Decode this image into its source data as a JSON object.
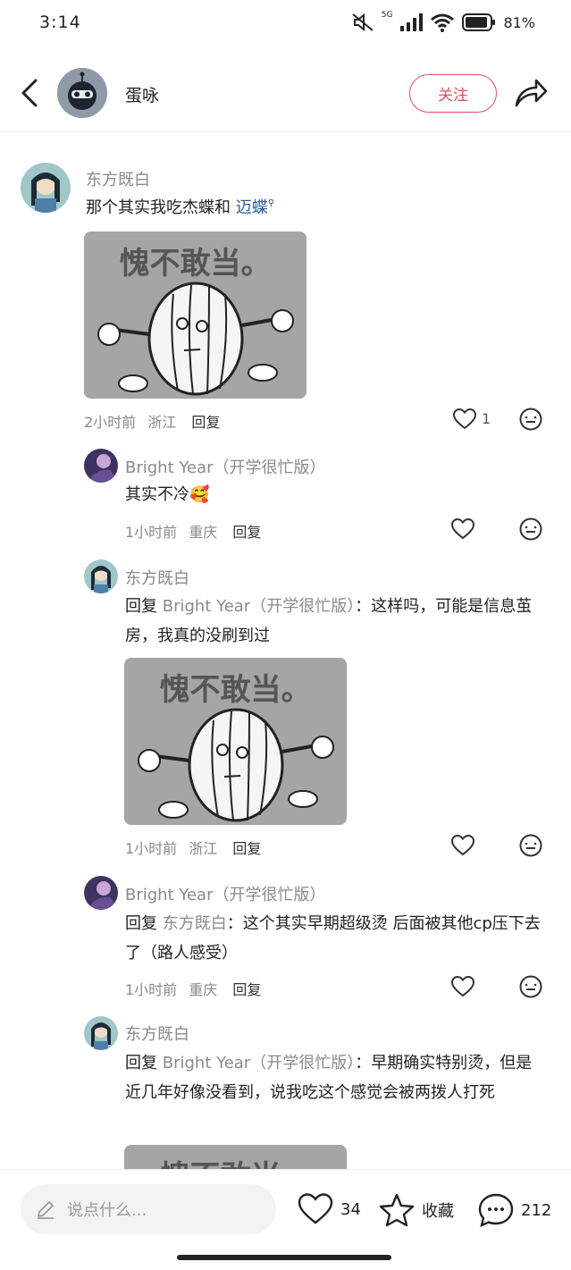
{
  "status_bar": {
    "time": "3:14",
    "network": "5G",
    "battery": "81%"
  },
  "header": {
    "title": "蛋咏",
    "follow_label": "关注"
  },
  "comments": [
    {
      "name": "东方既白",
      "text_prefix": "那个其实我吃杰蝶和 ",
      "link_text": "迈蝶",
      "meme_caption": "愧不敢当。",
      "time": "2小时前",
      "location": "浙江",
      "reply_label": "回复",
      "likes": "1"
    },
    {
      "name": "Bright Year（开学很忙版）",
      "text": "其实不冷",
      "emoji": "🥰",
      "time": "1小时前",
      "location": "重庆",
      "reply_label": "回复"
    },
    {
      "name": "东方既白",
      "reply_word": "回复 ",
      "reply_target": "Bright Year（开学很忙版）",
      "text": "：这样吗，可能是信息茧房，我真的没刷到过",
      "meme_caption": "愧不敢当。",
      "time": "1小时前",
      "location": "浙江",
      "reply_label": "回复"
    },
    {
      "name": "Bright Year（开学很忙版）",
      "reply_word": "回复 ",
      "reply_target": "东方既白",
      "text": "：这个其实早期超级烫 后面被其他cp压下去了（路人感受）",
      "time": "1小时前",
      "location": "重庆",
      "reply_label": "回复"
    },
    {
      "name": "东方既白",
      "reply_word": "回复 ",
      "reply_target": "Bright Year（开学很忙版）",
      "text": "：早期确实特别烫，但是近几年好像没看到，说我吃这个感觉会被两拨人打死",
      "meme_caption": "愧不敢当。"
    }
  ],
  "bottom_bar": {
    "input_placeholder": "说点什么...",
    "likes": "34",
    "favorite_label": "收藏",
    "comments": "212"
  },
  "colors": {
    "accent": "#e0505a",
    "link": "#2f5b9a",
    "muted": "#8a8a8a"
  },
  "icons": [
    "back-icon",
    "share-icon",
    "heart-icon",
    "more-icon",
    "pencil-icon",
    "star-icon",
    "comment-icon",
    "wifi-icon",
    "signal-icon",
    "battery-icon",
    "mute-icon"
  ]
}
